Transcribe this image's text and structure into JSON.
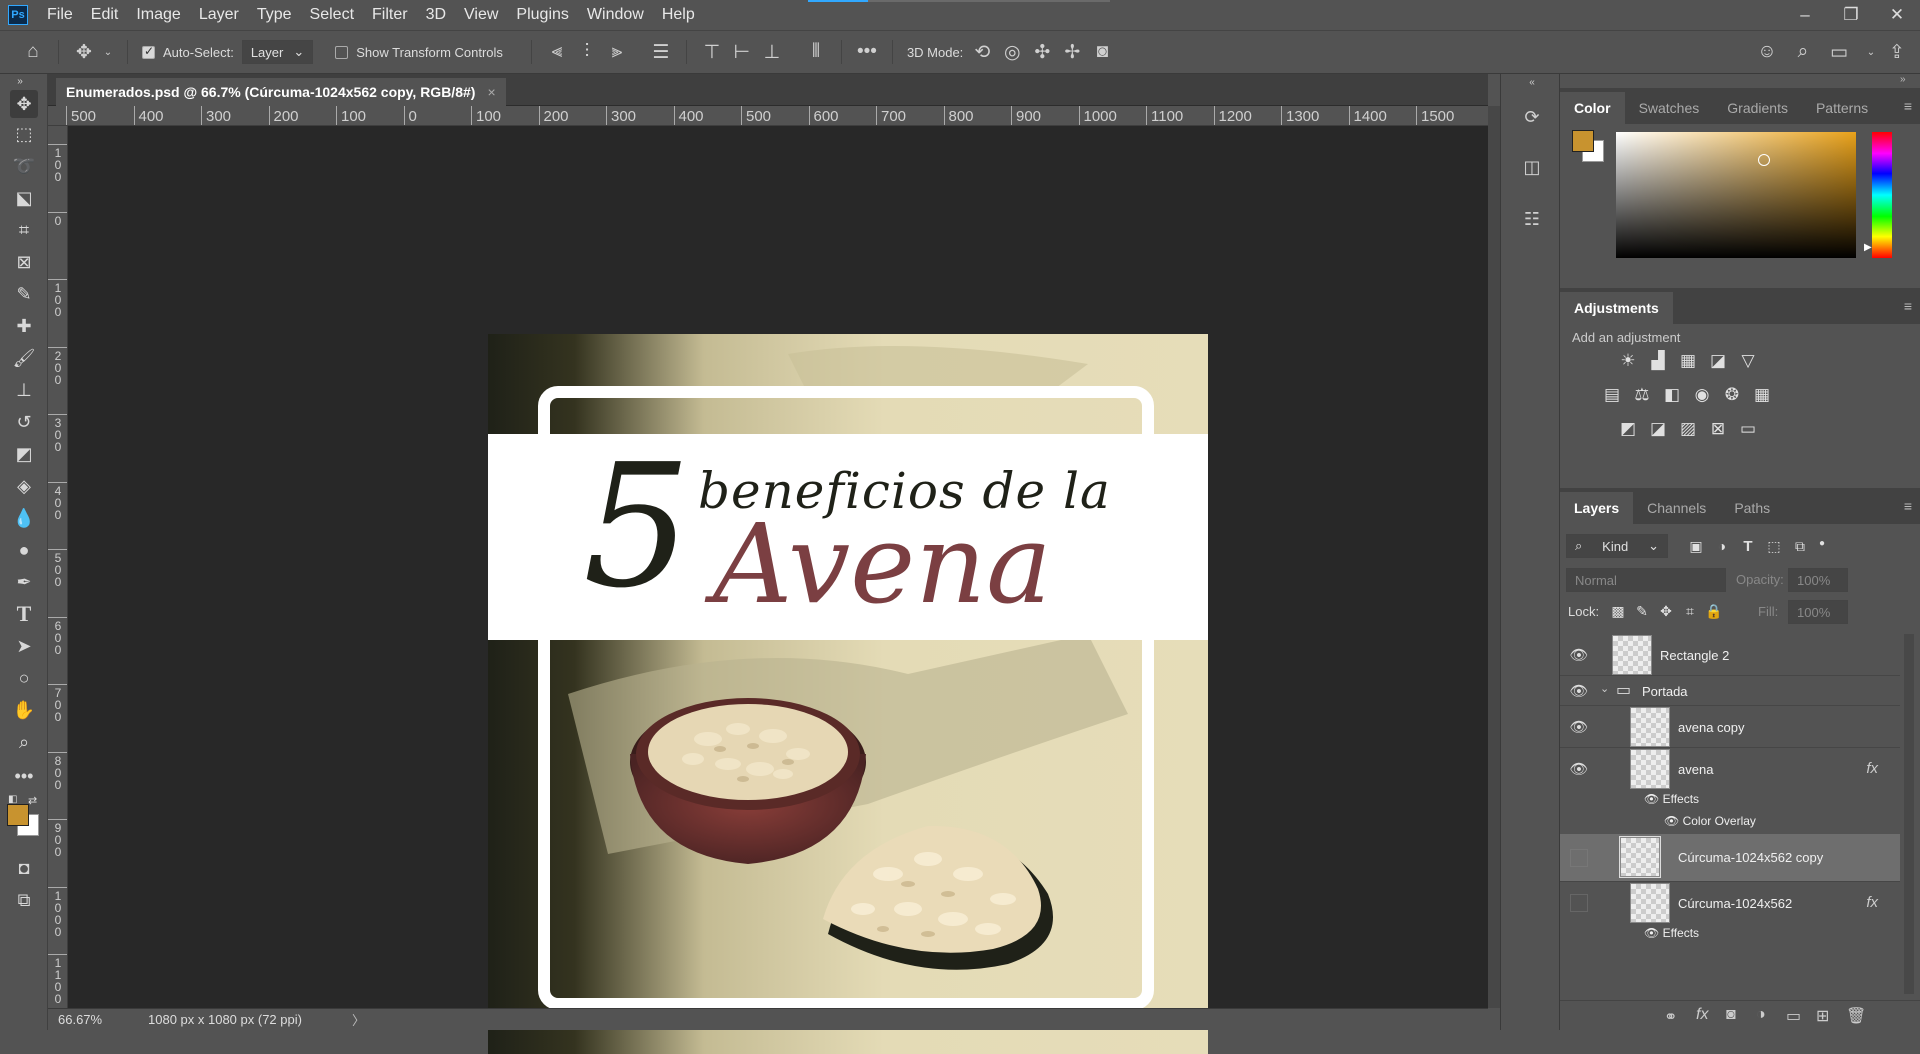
{
  "app": {
    "logo": "Ps",
    "menus": [
      "File",
      "Edit",
      "Image",
      "Layer",
      "Type",
      "Select",
      "Filter",
      "3D",
      "View",
      "Plugins",
      "Window",
      "Help"
    ]
  },
  "window_controls": {
    "minimize": "–",
    "restore": "❐",
    "close": "✕"
  },
  "options": {
    "auto_select_label": "Auto-Select:",
    "auto_select_checked": true,
    "auto_select_target": "Layer",
    "show_transform_label": "Show Transform Controls",
    "show_transform_checked": false,
    "mode3d_label": "3D Mode:",
    "more": "•••"
  },
  "document": {
    "tab_title": "Enumerados.psd @ 66.7% (Cúrcuma-1024x562 copy, RGB/8#)",
    "tab_close": "×",
    "zoom": "66.67%",
    "info": "1080 px x 1080 px (72 ppi)",
    "info_arrow": "〉"
  },
  "ruler": {
    "h_labels": [
      "500",
      "400",
      "300",
      "200",
      "100",
      "0",
      "100",
      "200",
      "300",
      "400",
      "500",
      "600",
      "700",
      "800",
      "900",
      "1000",
      "1100",
      "1200",
      "1300",
      "1400",
      "1500"
    ],
    "v_labels": [
      "1\n0\n0",
      "0",
      "1\n0\n0",
      "2\n0\n0",
      "3\n0\n0",
      "4\n0\n0",
      "5\n0\n0",
      "6\n0\n0",
      "7\n0\n0",
      "8\n0\n0",
      "9\n0\n0",
      "1\n0\n0\n0",
      "1\n1\n0\n0"
    ]
  },
  "artwork": {
    "number": "5",
    "line1": "beneficios de la",
    "line2": "Avena"
  },
  "colors": {
    "foreground": "#c8932f",
    "background": "#ffffff",
    "accent_blue": "#31a8ff",
    "title_dark": "#1f2118",
    "title_red": "#7b3f42"
  },
  "color_panel": {
    "tabs": [
      "Color",
      "Swatches",
      "Gradients",
      "Patterns"
    ],
    "active": "Color"
  },
  "adjustments_panel": {
    "title": "Adjustments",
    "subtitle": "Add an adjustment"
  },
  "layers_panel": {
    "tabs": [
      "Layers",
      "Channels",
      "Paths"
    ],
    "active": "Layers",
    "kind": "Kind",
    "blend": "Normal",
    "opacity_label": "Opacity:",
    "opacity": "100%",
    "lock_label": "Lock:",
    "fill_label": "Fill:",
    "fill": "100%",
    "layers": [
      {
        "name": "Rectangle 2",
        "visible": true
      },
      {
        "name": "Portada",
        "visible": true,
        "group": true
      },
      {
        "name": "avena copy",
        "visible": true
      },
      {
        "name": "avena",
        "visible": true,
        "fx": "fx",
        "effects": "Effects",
        "effect": "Color Overlay"
      },
      {
        "name": "Cúrcuma-1024x562 copy",
        "visible": false,
        "selected": true
      },
      {
        "name": "Cúrcuma-1024x562",
        "visible": false,
        "fx": "fx",
        "effects": "Effects"
      }
    ]
  }
}
